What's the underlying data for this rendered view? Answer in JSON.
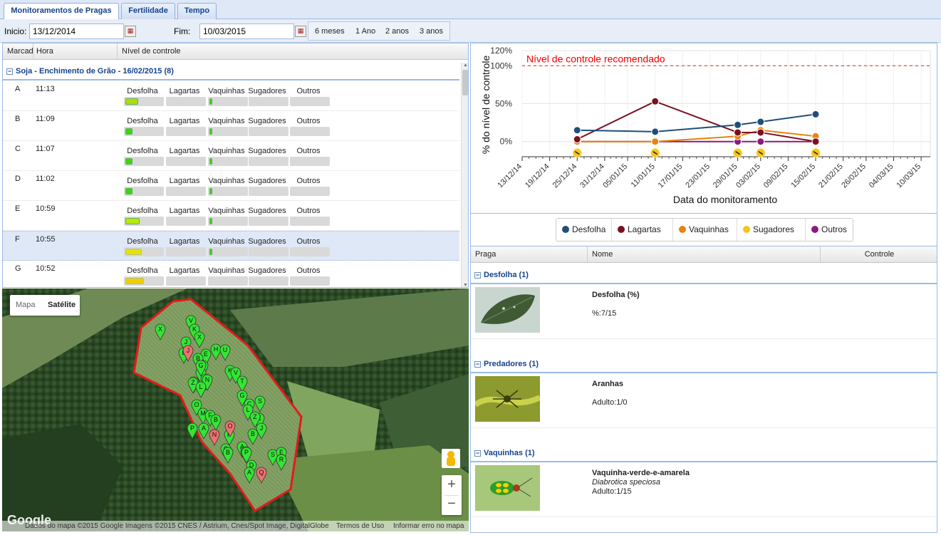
{
  "tabs": [
    {
      "label": "Monitoramentos de Pragas",
      "active": true
    },
    {
      "label": "Fertilidade",
      "active": false
    },
    {
      "label": "Tempo",
      "active": false
    }
  ],
  "toolbar": {
    "inicio_label": "Inicio:",
    "inicio_value": "13/12/2014",
    "fim_label": "Fim:",
    "fim_value": "10/03/2015",
    "ranges": [
      "6 meses",
      "1 Ano",
      "2 anos",
      "3 anos"
    ]
  },
  "grid": {
    "headers": [
      "Marcad",
      "Hora",
      "Nível de controle"
    ],
    "group": "Soja - Enchimento de Grão - 16/02/2015 (8)",
    "categories": [
      "Desfolha",
      "Lagartas",
      "Vaquinhas",
      "Sugadores",
      "Outros"
    ],
    "rows": [
      {
        "mark": "A",
        "time": "11:13",
        "levels": [
          0.35,
          0,
          0.08,
          0,
          0
        ],
        "color": "#aee000"
      },
      {
        "mark": "B",
        "time": "11:09",
        "levels": [
          0.2,
          0,
          0.08,
          0,
          0
        ],
        "color": "#33dd00"
      },
      {
        "mark": "C",
        "time": "11:07",
        "levels": [
          0.2,
          0,
          0.08,
          0,
          0
        ],
        "color": "#33dd00"
      },
      {
        "mark": "D",
        "time": "11:02",
        "levels": [
          0.2,
          0,
          0.08,
          0,
          0
        ],
        "color": "#33dd00"
      },
      {
        "mark": "E",
        "time": "10:59",
        "levels": [
          0.38,
          0,
          0.08,
          0,
          0
        ],
        "color": "#bbea00"
      },
      {
        "mark": "F",
        "time": "10:55",
        "levels": [
          0.45,
          0,
          0.08,
          0,
          0
        ],
        "color": "#e4e400"
      },
      {
        "mark": "G",
        "time": "10:52",
        "levels": [
          0.5,
          0,
          0,
          0,
          0
        ],
        "color": "#ecd000"
      }
    ]
  },
  "map": {
    "type_map": "Mapa",
    "type_sat": "Satélite",
    "footer": "Dados do mapa ©2015 Google Imagens ©2015 CNES / Astrium, Cnes/Spot Image, DigitalGlobe",
    "terms": "Termos de Uso",
    "report": "Informar erro no mapa",
    "logo": "Google",
    "zoom_in": "+",
    "zoom_out": "−",
    "pins_green": [
      "X",
      "V",
      "K",
      "X",
      "J",
      "L",
      "H",
      "E",
      "U",
      "B",
      "W",
      "I",
      "G",
      "D",
      "K",
      "V",
      "T",
      "F",
      "N",
      "Z",
      "L",
      "G",
      "C",
      "S",
      "L",
      "O",
      "M",
      "F",
      "B",
      "E",
      "Z",
      "P",
      "A",
      "P",
      "B",
      "J",
      "A",
      "H",
      "C",
      "B",
      "P",
      "S",
      "E",
      "R",
      "D",
      "A",
      "Q"
    ],
    "pins_red": [
      "J",
      "O",
      "N",
      "Q"
    ]
  },
  "chart_data": {
    "type": "line",
    "ylabel": "% do nível de controle",
    "xlabel": "Data do monitoramento",
    "reference_label": "Nível de controle recomendado",
    "reference_value": 100,
    "yticks": [
      "120%",
      "100%",
      "50%",
      "0%"
    ],
    "ylim": [
      -20,
      120
    ],
    "xticks": [
      "13/12/14",
      "19/12/14",
      "25/12/14",
      "31/12/14",
      "05/01/15",
      "11/01/15",
      "17/01/15",
      "23/01/15",
      "29/01/15",
      "03/02/15",
      "09/02/15",
      "15/02/15",
      "21/02/15",
      "26/02/15",
      "04/03/15",
      "10/03/15"
    ],
    "x": [
      "25/12/14",
      "11/01/15",
      "29/01/15",
      "03/02/15",
      "15/02/15"
    ],
    "series": [
      {
        "name": "Desfolha",
        "color": "#1f4e79",
        "values": [
          15,
          13,
          22,
          26,
          36
        ]
      },
      {
        "name": "Lagartas",
        "color": "#7b1020",
        "values": [
          3,
          53,
          12,
          12,
          0
        ]
      },
      {
        "name": "Vaquinhas",
        "color": "#e8830e",
        "values": [
          0,
          0,
          7,
          15,
          7
        ]
      },
      {
        "name": "Sugadores",
        "color": "#f5c518",
        "values": [
          0,
          0,
          0,
          0,
          0
        ]
      },
      {
        "name": "Outros",
        "color": "#8b1a7e",
        "values": [
          0,
          0,
          0,
          0,
          0
        ]
      }
    ]
  },
  "pest_grid": {
    "headers": [
      "Praga",
      "Nome",
      "Controle"
    ],
    "groups": [
      {
        "title": "Desfolha (1)",
        "name": "Desfolha (%)",
        "sci": "",
        "value": "%:7/15",
        "thumb": "leaf"
      },
      {
        "title": "Predadores (1)",
        "name": "Aranhas",
        "sci": "",
        "value": "Adulto:1/0",
        "thumb": "spider"
      },
      {
        "title": "Vaquinhas (1)",
        "name": "Vaquinha-verde-e-amarela",
        "sci": "Diabrotica speciosa",
        "value": "Adulto:1/15",
        "thumb": "beetle"
      }
    ]
  }
}
